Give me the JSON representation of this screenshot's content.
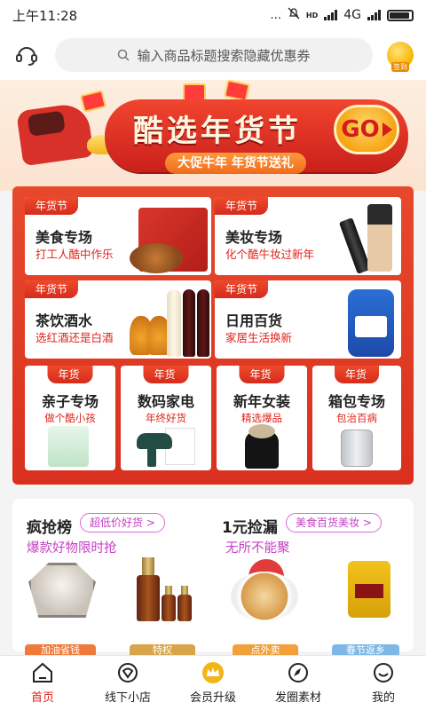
{
  "status_bar": {
    "time": "上午11:28",
    "dots": "...",
    "hd1": "HD",
    "net": "4G"
  },
  "search": {
    "placeholder": "输入商品标题搜索隐藏优惠券"
  },
  "coin": {
    "label": "签到"
  },
  "banner": {
    "title": "酷选年货节",
    "subtitle": "大促牛年 年货节送礼",
    "go": "GO"
  },
  "categories": {
    "tag": "年货节",
    "large": [
      {
        "title": "美食专场",
        "subtitle": "打工人酷中作乐"
      },
      {
        "title": "美妆专场",
        "subtitle": "化个酷牛妆过新年"
      },
      {
        "title": "茶饮酒水",
        "subtitle": "选红酒还是白酒"
      },
      {
        "title": "日用百货",
        "subtitle": "家居生活换新"
      }
    ],
    "small": [
      {
        "title": "亲子专场",
        "subtitle": "做个酷小孩"
      },
      {
        "title": "数码家电",
        "subtitle": "年终好货"
      },
      {
        "title": "新年女装",
        "subtitle": "精选爆品"
      },
      {
        "title": "箱包专场",
        "subtitle": "包治百病"
      }
    ]
  },
  "promo": {
    "left": {
      "title": "疯抢榜",
      "badge": "超低价好货 >",
      "subtitle": "爆款好物限时抢"
    },
    "right": {
      "title": "1元捡漏",
      "badge": "美食百货美妆 >",
      "subtitle": "无所不能聚"
    }
  },
  "peek": [
    "加油省钱",
    "特权",
    "点外卖",
    "春节返乡"
  ],
  "tabs": [
    {
      "label": "首页",
      "icon": "home-icon",
      "active": true
    },
    {
      "label": "线下小店",
      "icon": "store-icon",
      "active": false
    },
    {
      "label": "会员升级",
      "icon": "crown-icon",
      "active": false
    },
    {
      "label": "发圈素材",
      "icon": "compass-icon",
      "active": false
    },
    {
      "label": "我的",
      "icon": "profile-icon",
      "active": false
    }
  ],
  "colors": {
    "accent": "#e0231b",
    "banner_red": "#d9301f",
    "badge_purple": "#c43fc4"
  }
}
